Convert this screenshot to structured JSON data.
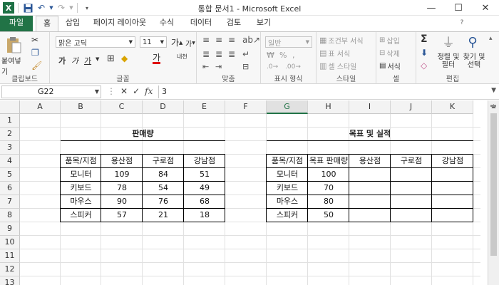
{
  "title_bar": {
    "title": "통합 문서1  -  Microsoft Excel",
    "app_icon_letter": "X",
    "minimize": "—",
    "maximize": "☐",
    "close": "✕"
  },
  "tabs": [
    {
      "label": "파일",
      "kind": "file"
    },
    {
      "label": "홈",
      "kind": "active"
    },
    {
      "label": "삽입"
    },
    {
      "label": "페이지 레이아웃"
    },
    {
      "label": "수식"
    },
    {
      "label": "데이터"
    },
    {
      "label": "검토"
    },
    {
      "label": "보기"
    }
  ],
  "ribbon": {
    "clipboard": {
      "label": "클립보드",
      "paste": "붙여넣기"
    },
    "font": {
      "label": "글꼴",
      "font_name": "맑은 고딕",
      "font_size": "11",
      "grow": "가",
      "shrink": "가",
      "bold": "가",
      "italic": "가",
      "underline": "가",
      "phonetic": "내천",
      "font_color_glyph": "가"
    },
    "alignment": {
      "label": "맞춤"
    },
    "number": {
      "label": "표시 형식",
      "format": "일반"
    },
    "styles": {
      "label": "스타일",
      "conditional": "조건부 서식",
      "table": "표 서식",
      "cell_style": "셀 스타일"
    },
    "cells": {
      "label": "셀",
      "insert": "삽입",
      "delete": "삭제",
      "format": "서식"
    },
    "editing": {
      "label": "편집",
      "sigma": "Σ",
      "sort_filter": "정렬 및 필터",
      "find_select": "찾기 및 선택"
    }
  },
  "formula_bar": {
    "name_box": "G22",
    "cancel": "✕",
    "enter": "✓",
    "fx": "fx",
    "value": "3"
  },
  "columns": [
    "A",
    "B",
    "C",
    "D",
    "E",
    "F",
    "G",
    "H",
    "I",
    "J",
    "K"
  ],
  "selected_column": "G",
  "rows": [
    "1",
    "2",
    "3",
    "4",
    "5",
    "6",
    "7",
    "8",
    "9",
    "10",
    "11",
    "12",
    "13"
  ],
  "table1": {
    "title": "판매량",
    "headers": [
      "품목/지점",
      "용산점",
      "구로점",
      "강남점"
    ],
    "rows": [
      [
        "모니터",
        "109",
        "84",
        "51"
      ],
      [
        "키보드",
        "78",
        "54",
        "49"
      ],
      [
        "마우스",
        "90",
        "76",
        "68"
      ],
      [
        "스피커",
        "57",
        "21",
        "18"
      ]
    ]
  },
  "table2": {
    "title": "목표 및 실적",
    "headers": [
      "품목/지점",
      "목표 판매량",
      "용산점",
      "구로점",
      "강남점"
    ],
    "rows": [
      [
        "모니터",
        "100",
        "",
        "",
        ""
      ],
      [
        "키보드",
        "70",
        "",
        "",
        ""
      ],
      [
        "마우스",
        "80",
        "",
        "",
        ""
      ],
      [
        "스피커",
        "50",
        "",
        "",
        ""
      ]
    ]
  }
}
